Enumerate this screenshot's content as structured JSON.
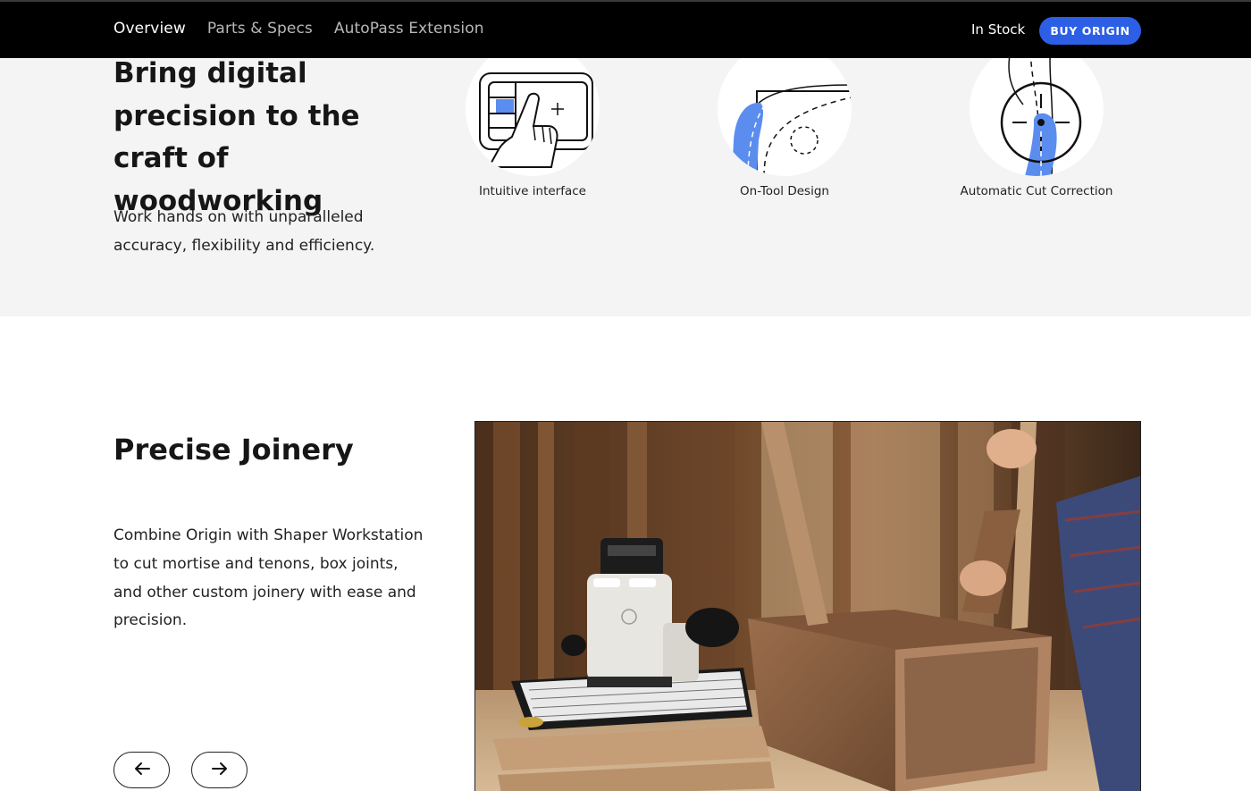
{
  "nav": {
    "links": [
      {
        "label": "Overview"
      },
      {
        "label": "Parts & Specs"
      },
      {
        "label": "AutoPass Extension"
      }
    ],
    "stock_status": "In Stock",
    "buy_label": "BUY ORIGIN"
  },
  "features_section": {
    "title": "Bring digital precision to the craft of woodworking",
    "description": "Work hands on with unparalleled accuracy, flexibility and efficiency.",
    "items": [
      {
        "label": "Intuitive interface",
        "icon": "touch-interface-icon"
      },
      {
        "label": "On-Tool Design",
        "icon": "on-tool-design-icon"
      },
      {
        "label": "Automatic Cut Correction",
        "icon": "cut-correction-icon"
      }
    ]
  },
  "joinery_section": {
    "title": "Precise Joinery",
    "description": "Combine Origin with Shaper Workstation to cut mortise and tenons, box joints, and other custom joinery with ease and precision."
  },
  "colors": {
    "accent_blue": "#2d5fe6",
    "icon_blue": "#5b8def",
    "nav_bg": "#000000",
    "section_bg": "#f4f4f4"
  }
}
